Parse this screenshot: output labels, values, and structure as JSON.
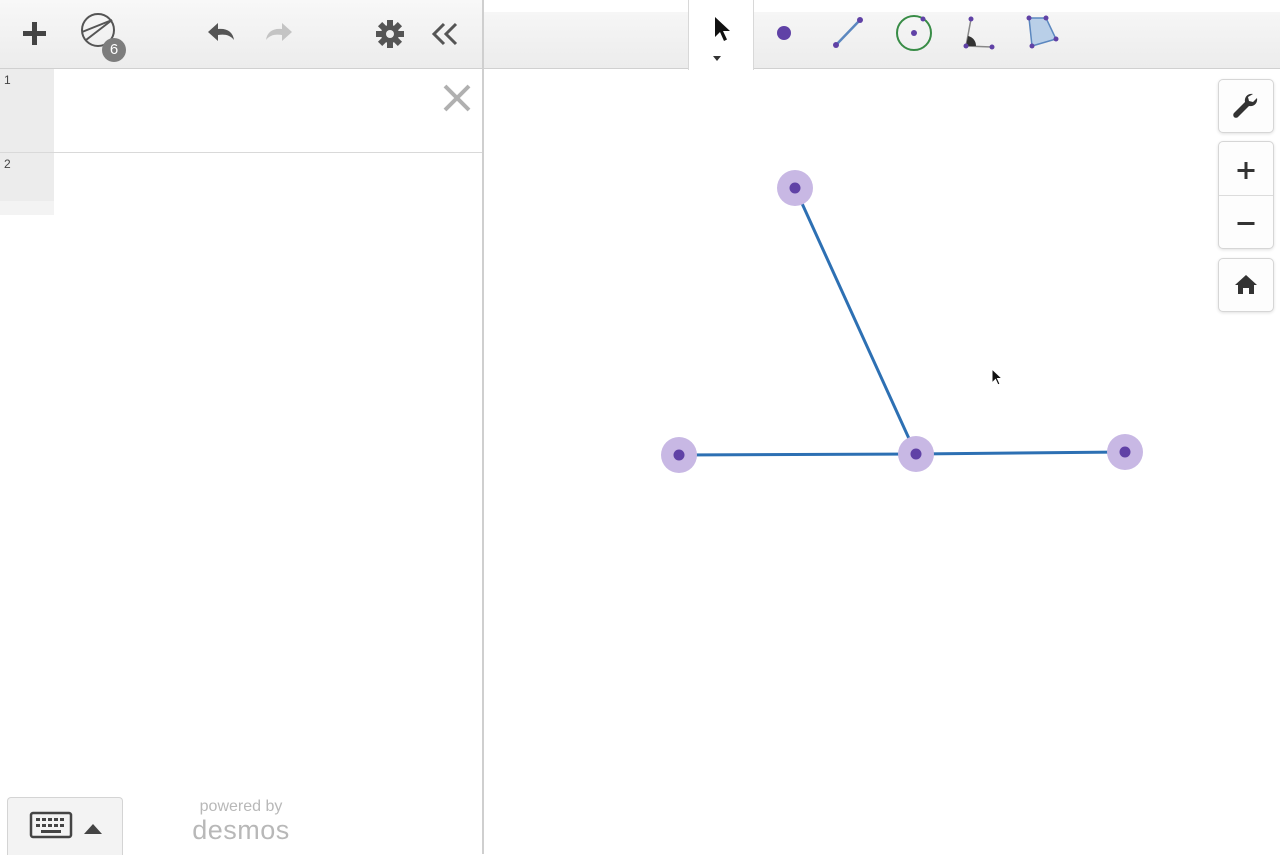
{
  "expressions": {
    "rows": [
      {
        "number": "1"
      },
      {
        "number": "2"
      }
    ]
  },
  "header": {
    "tool_count_badge": "6",
    "icons": [
      "plus-icon",
      "geometry-tools-icon",
      "undo-icon",
      "redo-icon",
      "gear-icon",
      "collapse-icon"
    ]
  },
  "toolbar": {
    "tools": [
      "select-tool",
      "point-tool",
      "segment-tool",
      "circle-tool",
      "angle-tool",
      "polygon-tool"
    ]
  },
  "footer": {
    "powered_by": "powered by",
    "brand": "desmos"
  },
  "graph_controls": [
    "wrench-icon",
    "zoom-in-icon",
    "zoom-out-icon",
    "home-icon"
  ],
  "colors": {
    "point": "#6042a6",
    "point_halo": "#c8b8e4",
    "segment": "#2d70b3",
    "circle_tool": "#388c46",
    "polygon_fill": "#b9cfe8"
  }
}
